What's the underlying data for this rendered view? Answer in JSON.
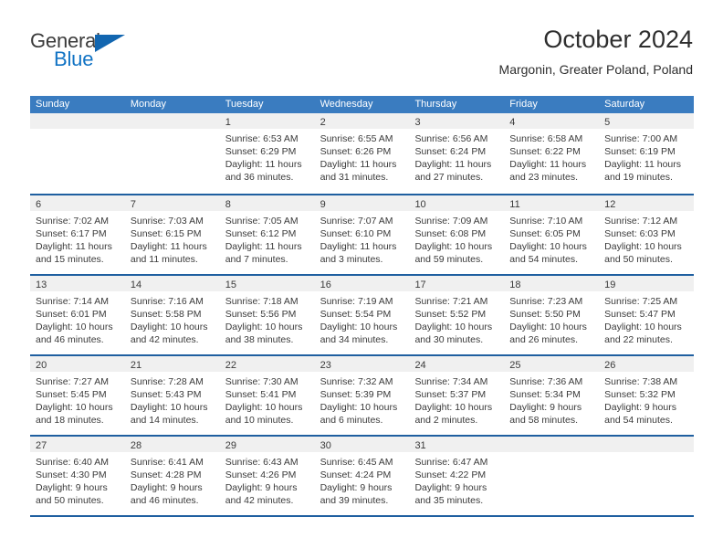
{
  "brand": {
    "name_part1": "General",
    "name_part2": "Blue",
    "flag_icon": "triangle-flag-icon"
  },
  "header": {
    "title": "October 2024",
    "subtitle": "Margonin, Greater Poland, Poland"
  },
  "calendar": {
    "weekday_headers": [
      "Sunday",
      "Monday",
      "Tuesday",
      "Wednesday",
      "Thursday",
      "Friday",
      "Saturday"
    ],
    "colors": {
      "header_bg": "#3a7cc0",
      "header_text": "#ffffff",
      "week_separator": "#1f5fa0",
      "day_band_bg": "#f0f0f0",
      "brand_blue": "#1173c4",
      "text": "#3a3a3a"
    },
    "weeks": [
      [
        {
          "day": "",
          "sunrise": "",
          "sunset": "",
          "daylight_line1": "",
          "daylight_line2": ""
        },
        {
          "day": "",
          "sunrise": "",
          "sunset": "",
          "daylight_line1": "",
          "daylight_line2": ""
        },
        {
          "day": "1",
          "sunrise": "Sunrise: 6:53 AM",
          "sunset": "Sunset: 6:29 PM",
          "daylight_line1": "Daylight: 11 hours",
          "daylight_line2": "and 36 minutes."
        },
        {
          "day": "2",
          "sunrise": "Sunrise: 6:55 AM",
          "sunset": "Sunset: 6:26 PM",
          "daylight_line1": "Daylight: 11 hours",
          "daylight_line2": "and 31 minutes."
        },
        {
          "day": "3",
          "sunrise": "Sunrise: 6:56 AM",
          "sunset": "Sunset: 6:24 PM",
          "daylight_line1": "Daylight: 11 hours",
          "daylight_line2": "and 27 minutes."
        },
        {
          "day": "4",
          "sunrise": "Sunrise: 6:58 AM",
          "sunset": "Sunset: 6:22 PM",
          "daylight_line1": "Daylight: 11 hours",
          "daylight_line2": "and 23 minutes."
        },
        {
          "day": "5",
          "sunrise": "Sunrise: 7:00 AM",
          "sunset": "Sunset: 6:19 PM",
          "daylight_line1": "Daylight: 11 hours",
          "daylight_line2": "and 19 minutes."
        }
      ],
      [
        {
          "day": "6",
          "sunrise": "Sunrise: 7:02 AM",
          "sunset": "Sunset: 6:17 PM",
          "daylight_line1": "Daylight: 11 hours",
          "daylight_line2": "and 15 minutes."
        },
        {
          "day": "7",
          "sunrise": "Sunrise: 7:03 AM",
          "sunset": "Sunset: 6:15 PM",
          "daylight_line1": "Daylight: 11 hours",
          "daylight_line2": "and 11 minutes."
        },
        {
          "day": "8",
          "sunrise": "Sunrise: 7:05 AM",
          "sunset": "Sunset: 6:12 PM",
          "daylight_line1": "Daylight: 11 hours",
          "daylight_line2": "and 7 minutes."
        },
        {
          "day": "9",
          "sunrise": "Sunrise: 7:07 AM",
          "sunset": "Sunset: 6:10 PM",
          "daylight_line1": "Daylight: 11 hours",
          "daylight_line2": "and 3 minutes."
        },
        {
          "day": "10",
          "sunrise": "Sunrise: 7:09 AM",
          "sunset": "Sunset: 6:08 PM",
          "daylight_line1": "Daylight: 10 hours",
          "daylight_line2": "and 59 minutes."
        },
        {
          "day": "11",
          "sunrise": "Sunrise: 7:10 AM",
          "sunset": "Sunset: 6:05 PM",
          "daylight_line1": "Daylight: 10 hours",
          "daylight_line2": "and 54 minutes."
        },
        {
          "day": "12",
          "sunrise": "Sunrise: 7:12 AM",
          "sunset": "Sunset: 6:03 PM",
          "daylight_line1": "Daylight: 10 hours",
          "daylight_line2": "and 50 minutes."
        }
      ],
      [
        {
          "day": "13",
          "sunrise": "Sunrise: 7:14 AM",
          "sunset": "Sunset: 6:01 PM",
          "daylight_line1": "Daylight: 10 hours",
          "daylight_line2": "and 46 minutes."
        },
        {
          "day": "14",
          "sunrise": "Sunrise: 7:16 AM",
          "sunset": "Sunset: 5:58 PM",
          "daylight_line1": "Daylight: 10 hours",
          "daylight_line2": "and 42 minutes."
        },
        {
          "day": "15",
          "sunrise": "Sunrise: 7:18 AM",
          "sunset": "Sunset: 5:56 PM",
          "daylight_line1": "Daylight: 10 hours",
          "daylight_line2": "and 38 minutes."
        },
        {
          "day": "16",
          "sunrise": "Sunrise: 7:19 AM",
          "sunset": "Sunset: 5:54 PM",
          "daylight_line1": "Daylight: 10 hours",
          "daylight_line2": "and 34 minutes."
        },
        {
          "day": "17",
          "sunrise": "Sunrise: 7:21 AM",
          "sunset": "Sunset: 5:52 PM",
          "daylight_line1": "Daylight: 10 hours",
          "daylight_line2": "and 30 minutes."
        },
        {
          "day": "18",
          "sunrise": "Sunrise: 7:23 AM",
          "sunset": "Sunset: 5:50 PM",
          "daylight_line1": "Daylight: 10 hours",
          "daylight_line2": "and 26 minutes."
        },
        {
          "day": "19",
          "sunrise": "Sunrise: 7:25 AM",
          "sunset": "Sunset: 5:47 PM",
          "daylight_line1": "Daylight: 10 hours",
          "daylight_line2": "and 22 minutes."
        }
      ],
      [
        {
          "day": "20",
          "sunrise": "Sunrise: 7:27 AM",
          "sunset": "Sunset: 5:45 PM",
          "daylight_line1": "Daylight: 10 hours",
          "daylight_line2": "and 18 minutes."
        },
        {
          "day": "21",
          "sunrise": "Sunrise: 7:28 AM",
          "sunset": "Sunset: 5:43 PM",
          "daylight_line1": "Daylight: 10 hours",
          "daylight_line2": "and 14 minutes."
        },
        {
          "day": "22",
          "sunrise": "Sunrise: 7:30 AM",
          "sunset": "Sunset: 5:41 PM",
          "daylight_line1": "Daylight: 10 hours",
          "daylight_line2": "and 10 minutes."
        },
        {
          "day": "23",
          "sunrise": "Sunrise: 7:32 AM",
          "sunset": "Sunset: 5:39 PM",
          "daylight_line1": "Daylight: 10 hours",
          "daylight_line2": "and 6 minutes."
        },
        {
          "day": "24",
          "sunrise": "Sunrise: 7:34 AM",
          "sunset": "Sunset: 5:37 PM",
          "daylight_line1": "Daylight: 10 hours",
          "daylight_line2": "and 2 minutes."
        },
        {
          "day": "25",
          "sunrise": "Sunrise: 7:36 AM",
          "sunset": "Sunset: 5:34 PM",
          "daylight_line1": "Daylight: 9 hours",
          "daylight_line2": "and 58 minutes."
        },
        {
          "day": "26",
          "sunrise": "Sunrise: 7:38 AM",
          "sunset": "Sunset: 5:32 PM",
          "daylight_line1": "Daylight: 9 hours",
          "daylight_line2": "and 54 minutes."
        }
      ],
      [
        {
          "day": "27",
          "sunrise": "Sunrise: 6:40 AM",
          "sunset": "Sunset: 4:30 PM",
          "daylight_line1": "Daylight: 9 hours",
          "daylight_line2": "and 50 minutes."
        },
        {
          "day": "28",
          "sunrise": "Sunrise: 6:41 AM",
          "sunset": "Sunset: 4:28 PM",
          "daylight_line1": "Daylight: 9 hours",
          "daylight_line2": "and 46 minutes."
        },
        {
          "day": "29",
          "sunrise": "Sunrise: 6:43 AM",
          "sunset": "Sunset: 4:26 PM",
          "daylight_line1": "Daylight: 9 hours",
          "daylight_line2": "and 42 minutes."
        },
        {
          "day": "30",
          "sunrise": "Sunrise: 6:45 AM",
          "sunset": "Sunset: 4:24 PM",
          "daylight_line1": "Daylight: 9 hours",
          "daylight_line2": "and 39 minutes."
        },
        {
          "day": "31",
          "sunrise": "Sunrise: 6:47 AM",
          "sunset": "Sunset: 4:22 PM",
          "daylight_line1": "Daylight: 9 hours",
          "daylight_line2": "and 35 minutes."
        },
        {
          "day": "",
          "sunrise": "",
          "sunset": "",
          "daylight_line1": "",
          "daylight_line2": ""
        },
        {
          "day": "",
          "sunrise": "",
          "sunset": "",
          "daylight_line1": "",
          "daylight_line2": ""
        }
      ]
    ]
  }
}
